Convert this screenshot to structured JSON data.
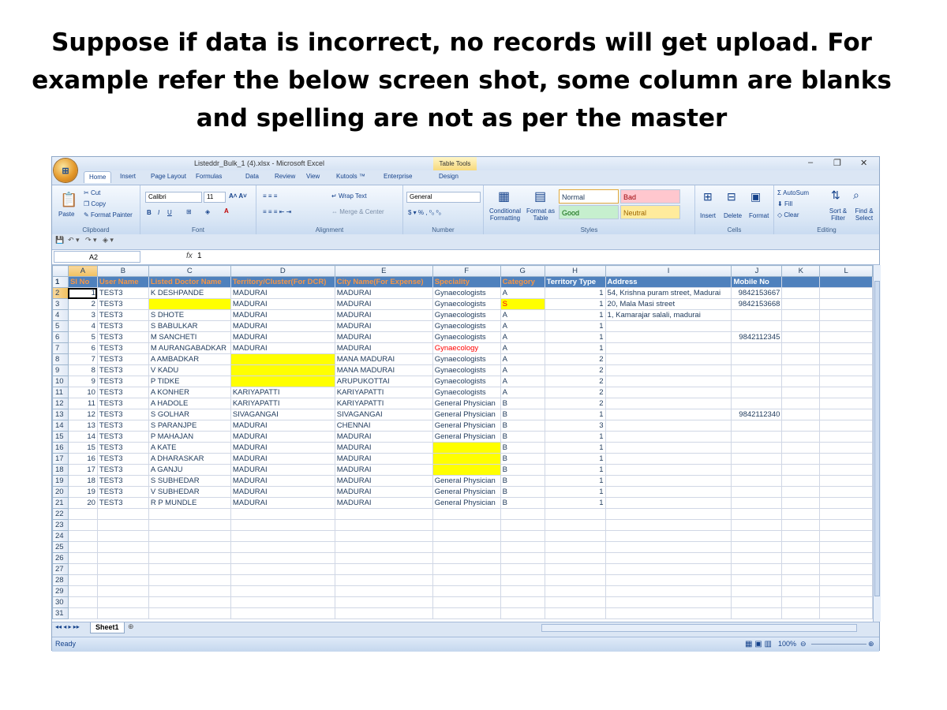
{
  "slide": {
    "title": "Suppose if data is incorrect, no records will get upload. For example refer the below screen shot, some column are blanks and spelling are not as per the master"
  },
  "window": {
    "title": "Listeddr_Bulk_1 (4).xlsx - Microsoft Excel",
    "context_tab": "Table Tools"
  },
  "ribbon": {
    "tabs": [
      "Home",
      "Insert",
      "Page Layout",
      "Formulas",
      "Data",
      "Review",
      "View",
      "Kutools ™",
      "Enterprise",
      "Design"
    ],
    "clipboard": {
      "paste": "Paste",
      "cut": "Cut",
      "copy": "Copy",
      "format_painter": "Format Painter",
      "label": "Clipboard"
    },
    "font": {
      "name": "Calibri",
      "size": "11",
      "label": "Font"
    },
    "alignment": {
      "wrap": "Wrap Text",
      "merge": "Merge & Center",
      "label": "Alignment"
    },
    "number": {
      "format": "General",
      "label": "Number"
    },
    "styles": {
      "conditional": "Conditional Formatting",
      "format_table": "Format as Table",
      "normal": "Normal",
      "bad": "Bad",
      "good": "Good",
      "neutral": "Neutral",
      "label": "Styles"
    },
    "cells": {
      "insert": "Insert",
      "delete": "Delete",
      "format": "Format",
      "label": "Cells"
    },
    "editing": {
      "autosum": "AutoSum",
      "fill": "Fill",
      "clear": "Clear",
      "sort": "Sort & Filter",
      "find": "Find & Select",
      "label": "Editing"
    }
  },
  "formula_bar": {
    "cell_ref": "A2",
    "fx": "fx",
    "value": "1"
  },
  "sheet": {
    "columns": [
      "A",
      "B",
      "C",
      "D",
      "E",
      "F",
      "G",
      "H",
      "I",
      "J",
      "K",
      "L"
    ],
    "headers": [
      "Sl No",
      "User Name",
      "Listed Doctor Name",
      "Territory/Cluster(For DCR)",
      "City Name(For Expense)",
      "Speciality",
      "Category",
      "Territory Type",
      "Address",
      "Mobile No"
    ],
    "rows": [
      [
        "1",
        "TEST3",
        "K DESHPANDE",
        "MADURAI",
        "MADURAI",
        "Gynaecologists",
        "A",
        "1",
        "54, Krishna puram street, Madurai",
        "9842153667"
      ],
      [
        "2",
        "TEST3",
        "",
        "MADURAI",
        "MADURAI",
        "Gynaecologists",
        "S",
        "1",
        "20, Mala Masi street",
        "9842153668"
      ],
      [
        "3",
        "TEST3",
        "S DHOTE",
        "MADURAI",
        "MADURAI",
        "Gynaecologists",
        "A",
        "1",
        "1, Kamarajar salali, madurai",
        ""
      ],
      [
        "4",
        "TEST3",
        "S BABULKAR",
        "MADURAI",
        "MADURAI",
        "Gynaecologists",
        "A",
        "1",
        "",
        ""
      ],
      [
        "5",
        "TEST3",
        "M SANCHETI",
        "MADURAI",
        "MADURAI",
        "Gynaecologists",
        "A",
        "1",
        "",
        "9842112345"
      ],
      [
        "6",
        "TEST3",
        "M AURANGABADKAR",
        "MADURAI",
        "MADURAI",
        "Gynaecology",
        "A",
        "1",
        "",
        ""
      ],
      [
        "7",
        "TEST3",
        "A AMBADKAR",
        "",
        "MANA MADURAI",
        "Gynaecologists",
        "A",
        "2",
        "",
        ""
      ],
      [
        "8",
        "TEST3",
        "V KADU",
        "",
        "MANA MADURAI",
        "Gynaecologists",
        "A",
        "2",
        "",
        ""
      ],
      [
        "9",
        "TEST3",
        "P TIDKE",
        "",
        "ARUPUKOTTAI",
        "Gynaecologists",
        "A",
        "2",
        "",
        ""
      ],
      [
        "10",
        "TEST3",
        "A KONHER",
        "KARIYAPATTI",
        "KARIYAPATTI",
        "Gynaecologists",
        "A",
        "2",
        "",
        ""
      ],
      [
        "11",
        "TEST3",
        "A HADOLE",
        "KARIYAPATTI",
        "KARIYAPATTI",
        "General Physician",
        "B",
        "2",
        "",
        ""
      ],
      [
        "12",
        "TEST3",
        "S GOLHAR",
        "SIVAGANGAI",
        "SIVAGANGAI",
        "General Physician",
        "B",
        "1",
        "",
        "9842112340"
      ],
      [
        "13",
        "TEST3",
        "S PARANJPE",
        "MADURAI",
        "CHENNAI",
        "General Physician",
        "B",
        "3",
        "",
        ""
      ],
      [
        "14",
        "TEST3",
        "P MAHAJAN",
        "MADURAI",
        "MADURAI",
        "General Physician",
        "B",
        "1",
        "",
        ""
      ],
      [
        "15",
        "TEST3",
        "A KATE",
        "MADURAI",
        "MADURAI",
        "",
        "B",
        "1",
        "",
        ""
      ],
      [
        "16",
        "TEST3",
        "A DHARASKAR",
        "MADURAI",
        "MADURAI",
        "",
        "B",
        "1",
        "",
        ""
      ],
      [
        "17",
        "TEST3",
        "A GANJU",
        "MADURAI",
        "MADURAI",
        "",
        "B",
        "1",
        "",
        ""
      ],
      [
        "18",
        "TEST3",
        "S SUBHEDAR",
        "MADURAI",
        "MADURAI",
        "General Physician",
        "B",
        "1",
        "",
        ""
      ],
      [
        "19",
        "TEST3",
        "V SUBHEDAR",
        "MADURAI",
        "MADURAI",
        "General Physician",
        "B",
        "1",
        "",
        ""
      ],
      [
        "20",
        "TEST3",
        "R P MUNDLE",
        "MADURAI",
        "MADURAI",
        "General Physician",
        "B",
        "1",
        "",
        ""
      ]
    ],
    "row_numbers": [
      "1",
      "2",
      "3",
      "4",
      "5",
      "6",
      "7",
      "8",
      "9",
      "10",
      "11",
      "12",
      "13",
      "14",
      "15",
      "16",
      "17",
      "18",
      "19",
      "20",
      "21",
      "22",
      "23",
      "24",
      "25",
      "26",
      "27",
      "28",
      "29",
      "30",
      "31"
    ],
    "highlighted_cells": [
      [
        2,
        2
      ],
      [
        2,
        6
      ],
      [
        7,
        3
      ],
      [
        8,
        3
      ],
      [
        9,
        3
      ],
      [
        15,
        5
      ],
      [
        16,
        5
      ],
      [
        17,
        5
      ]
    ],
    "red_text_cells": [
      [
        2,
        6
      ],
      [
        6,
        5
      ]
    ],
    "colors": {
      "header_bg": "#4f81bd",
      "highlight": "#ffff00",
      "error_text": "#ff0000",
      "orange_header": "#f79646"
    }
  },
  "sheet_tab": "Sheet1",
  "status": {
    "ready": "Ready",
    "zoom": "100%"
  }
}
